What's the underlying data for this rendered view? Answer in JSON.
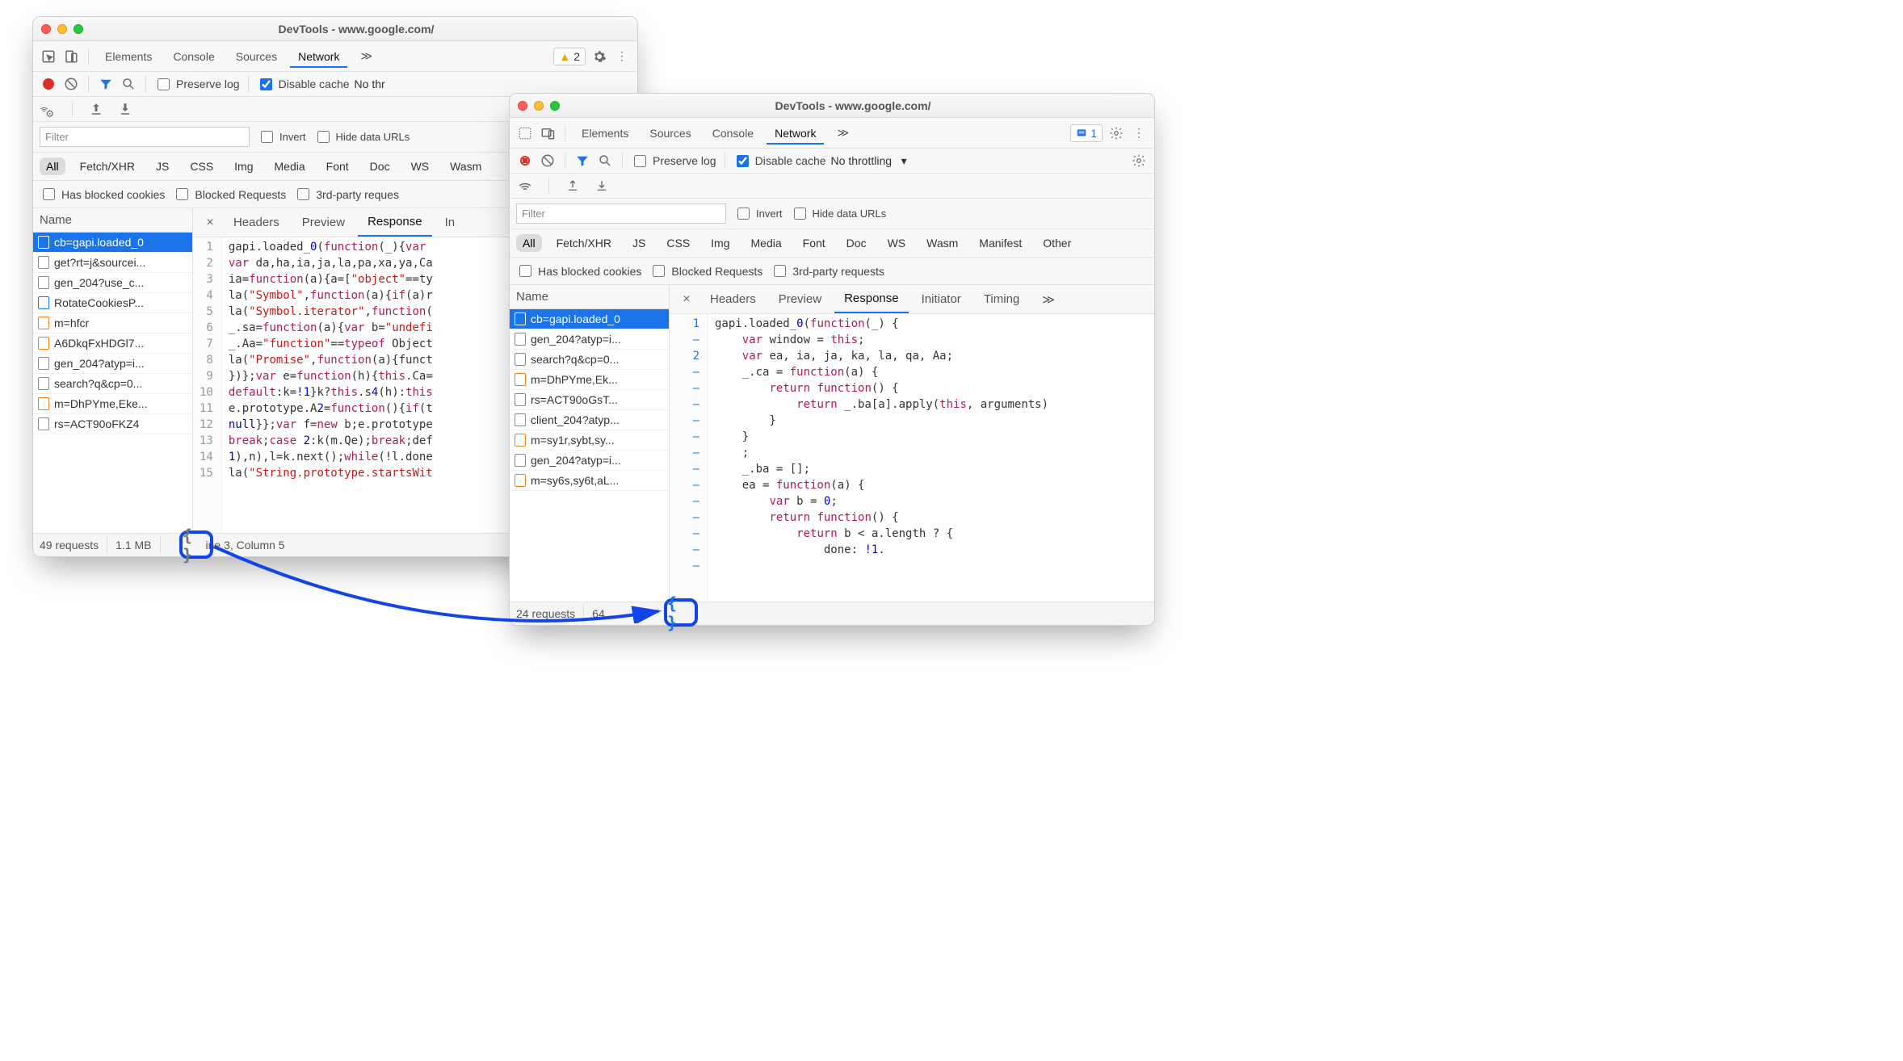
{
  "w1": {
    "title": "DevTools - www.google.com/",
    "tabs": [
      "Elements",
      "Console",
      "Sources",
      "Network"
    ],
    "tabsMore": "≫",
    "activeTab": "Network",
    "issuesCount": "2",
    "netbar": {
      "preserve": "Preserve log",
      "disableCache": "Disable cache",
      "throttle": "No thr"
    },
    "filter": {
      "placeholder": "Filter",
      "invert": "Invert",
      "hideData": "Hide data URLs"
    },
    "chips": [
      "All",
      "Fetch/XHR",
      "JS",
      "CSS",
      "Img",
      "Media",
      "Font",
      "Doc",
      "WS",
      "Wasm"
    ],
    "chipsActive": "All",
    "chipsRow2": {
      "hasBlocked": "Has blocked cookies",
      "blockedReq": "Blocked Requests",
      "thirdParty": "3rd-party reques"
    },
    "nameHeader": "Name",
    "files": [
      {
        "t": "js",
        "n": "cb=gapi.loaded_0",
        "sel": true
      },
      {
        "t": "doc",
        "n": "get?rt=j&sourcei..."
      },
      {
        "t": "doc",
        "n": "gen_204?use_c..."
      },
      {
        "t": "blue",
        "n": "RotateCookiesP..."
      },
      {
        "t": "js",
        "n": "m=hfcr"
      },
      {
        "t": "js",
        "n": "A6DkqFxHDGl7..."
      },
      {
        "t": "doc",
        "n": "gen_204?atyp=i..."
      },
      {
        "t": "doc",
        "n": "search?q&cp=0..."
      },
      {
        "t": "js",
        "n": "m=DhPYme,Eke..."
      },
      {
        "t": "doc",
        "n": "rs=ACT90oFKZ4"
      }
    ],
    "detailTabs": [
      "Headers",
      "Preview",
      "Response",
      "In"
    ],
    "detailActive": "Response",
    "code": {
      "lines": [
        "1",
        "2",
        "3",
        "4",
        "5",
        "6",
        "7",
        "8",
        "9",
        "10",
        "11",
        "12",
        "13",
        "14",
        "15"
      ],
      "src": [
        "gapi.loaded_0(function(_){var ",
        "var da,ha,ia,ja,la,pa,xa,ya,Ca",
        "ia=function(a){a=[\"object\"==ty",
        "la(\"Symbol\",function(a){if(a)r",
        "la(\"Symbol.iterator\",function(",
        "_.sa=function(a){var b=\"undefi",
        "_.Aa=\"function\"==typeof Object",
        "la(\"Promise\",function(a){funct",
        "})};var e=function(h){this.Ca=",
        "default:k=!1}k?this.s4(h):this",
        "e.prototype.A2=function(){if(t",
        "null}};var f=new b;e.prototype",
        "break;case 2:k(m.Qe);break;def",
        "1),n),l=k.next();while(!l.done",
        "la(\"String.prototype.startsWit"
      ]
    },
    "status": {
      "req": "49 requests",
      "size": "1.1 MB",
      "cursor": "ine 3, Column 5"
    }
  },
  "w2": {
    "title": "DevTools - www.google.com/",
    "tabs": [
      "Elements",
      "Sources",
      "Console",
      "Network"
    ],
    "tabsMore": "≫",
    "activeTab": "Network",
    "issuesCount": "1",
    "netbar": {
      "preserve": "Preserve log",
      "disableCache": "Disable cache",
      "throttle": "No throttling"
    },
    "filter": {
      "placeholder": "Filter",
      "invert": "Invert",
      "hideData": "Hide data URLs"
    },
    "chips": [
      "All",
      "Fetch/XHR",
      "JS",
      "CSS",
      "Img",
      "Media",
      "Font",
      "Doc",
      "WS",
      "Wasm",
      "Manifest",
      "Other"
    ],
    "chipsActive": "All",
    "chipsRow2": {
      "hasBlocked": "Has blocked cookies",
      "blockedReq": "Blocked Requests",
      "thirdParty": "3rd-party requests"
    },
    "nameHeader": "Name",
    "files": [
      {
        "t": "js",
        "n": "cb=gapi.loaded_0",
        "sel": true
      },
      {
        "t": "doc",
        "n": "gen_204?atyp=i..."
      },
      {
        "t": "doc",
        "n": "search?q&cp=0..."
      },
      {
        "t": "js",
        "n": "m=DhPYme,Ek..."
      },
      {
        "t": "doc",
        "n": "rs=ACT90oGsT..."
      },
      {
        "t": "doc",
        "n": "client_204?atyp..."
      },
      {
        "t": "js",
        "n": "m=sy1r,sybt,sy..."
      },
      {
        "t": "doc",
        "n": "gen_204?atyp=i..."
      },
      {
        "t": "js",
        "n": "m=sy6s,sy6t,aL..."
      }
    ],
    "detailTabs": [
      "Headers",
      "Preview",
      "Response",
      "Initiator",
      "Timing"
    ],
    "detailActive": "Response",
    "code": {
      "gutter": [
        "1",
        "–",
        "2",
        "–",
        "–",
        "–",
        "–",
        "–",
        "–",
        "–",
        "–",
        "–",
        "–",
        "–",
        "–",
        "–"
      ],
      "src": [
        "gapi.loaded_0(function(_) {",
        "    var window = this;",
        "    var ea, ia, ja, ka, la, qa, Aa;",
        "    _.ca = function(a) {",
        "        return function() {",
        "            return _.ba[a].apply(this, arguments)",
        "        }",
        "    }",
        "    ;",
        "    _.ba = [];",
        "    ea = function(a) {",
        "        var b = 0;",
        "        return function() {",
        "            return b < a.length ? {",
        "                done: !1."
      ]
    },
    "status": {
      "req": "24 requests",
      "size": "64"
    }
  }
}
